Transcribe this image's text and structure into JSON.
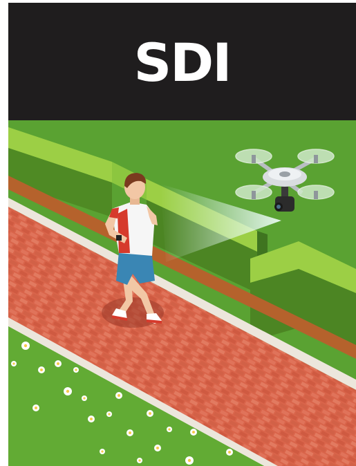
{
  "header": {
    "title": "SDI"
  },
  "illustration": {
    "subject": "jogger-drone-scene",
    "colors": {
      "header_bg": "#1f1d1e",
      "title": "#ffffff",
      "lawn": "#5aa232",
      "hedge": "#8cc63f",
      "path": "#d9644a",
      "path_edge": "#ece6dc",
      "drone_body": "#d9dde0",
      "beam": "#e6fbff"
    }
  }
}
